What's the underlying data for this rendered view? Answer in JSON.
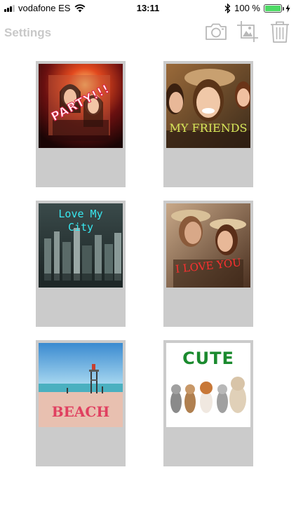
{
  "status_bar": {
    "carrier": "vodafone ES",
    "time": "13:11",
    "battery": "100 %",
    "battery_level": 1.0
  },
  "nav": {
    "settings_label": "Settings",
    "icons": [
      "camera-icon",
      "gallery-crop-icon",
      "trash-icon"
    ]
  },
  "cards": [
    {
      "caption": "PARTY!!!",
      "caption_color": "#ffffff",
      "stroke": "#e0204a"
    },
    {
      "caption": "MY FRIENDS",
      "caption_color": "#d8e85a"
    },
    {
      "caption_line1": "Love My",
      "caption_line2": "City",
      "caption_color": "#38e8f0"
    },
    {
      "caption": "I LOVE YOU",
      "caption_color": "#ff3030"
    },
    {
      "caption": "BEACH",
      "caption_color": "#e04060"
    },
    {
      "caption": "CUTE",
      "caption_color": "#1a8a2e"
    }
  ],
  "colors": {
    "card_bg": "#cbcbcb",
    "settings_disabled": "#c8c8c8",
    "icon_gray": "#b8b8b8"
  }
}
